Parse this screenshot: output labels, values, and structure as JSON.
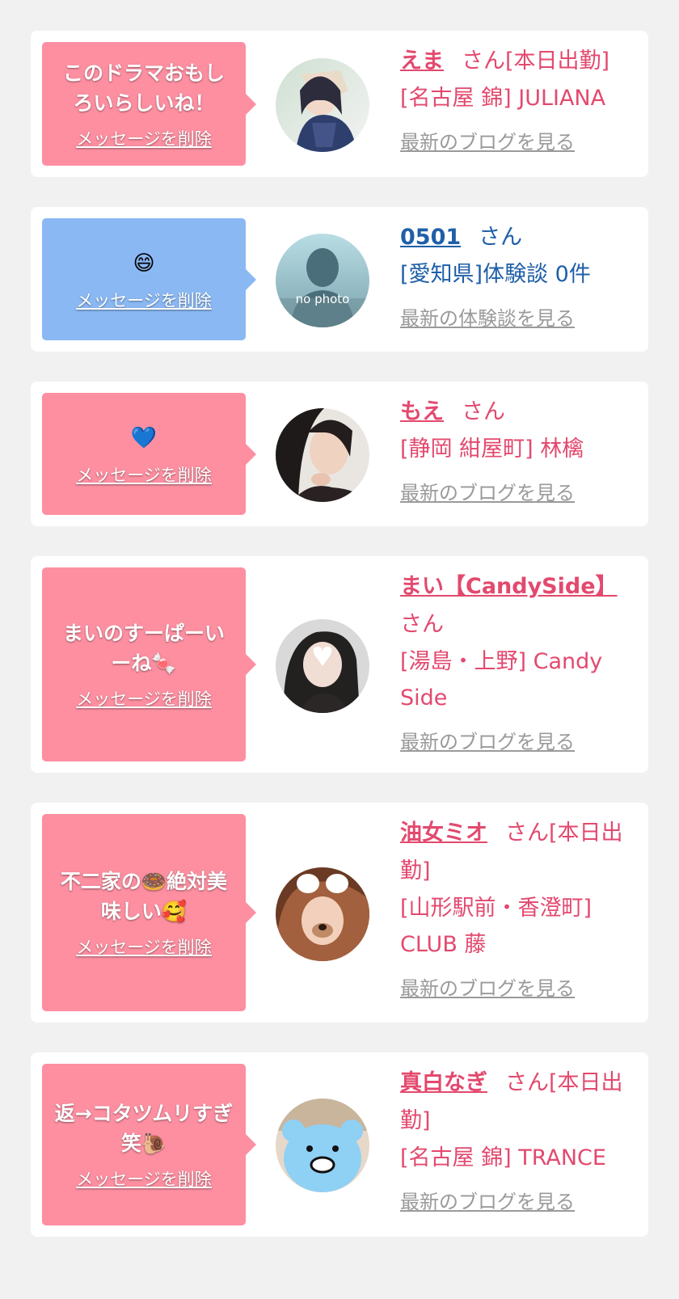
{
  "colors": {
    "page_bg": "#f1f1f1",
    "card_bg": "#ffffff",
    "bubble_pink": "#fd8fa1",
    "bubble_blue": "#8ab8f3",
    "name_pink": "#e3496e",
    "name_blue": "#1f5fa8",
    "link_gray": "#9a9a9a"
  },
  "delete_label": "メッセージを削除",
  "cards": [
    {
      "message": "このドラマおもしろいらしいね！",
      "emoji": "",
      "name": "えま",
      "suffix": "さん[本日出勤]",
      "area": "[名古屋 錦] JULIANA",
      "link": "最新のブログを見る",
      "bubble_color": "pink",
      "avatar": "photo"
    },
    {
      "message": "",
      "emoji": "😄",
      "name": "0501",
      "suffix": "さん",
      "area": "[愛知県]体験談 0件",
      "link": "最新の体験談を見る",
      "bubble_color": "blue",
      "avatar": "no-photo",
      "avatar_text": "no photo"
    },
    {
      "message": "",
      "emoji": "💙",
      "name": "もえ",
      "suffix": "さん",
      "area": "[静岡 紺屋町] 林檎",
      "link": "最新のブログを見る",
      "bubble_color": "pink",
      "avatar": "photo"
    },
    {
      "message": "まいのすーぱーいーね🍬",
      "emoji": "",
      "name": "まい【CandySide】",
      "suffix": "さん",
      "area": "[湯島・上野] Candy Side",
      "link": "最新のブログを見る",
      "bubble_color": "pink",
      "avatar": "photo"
    },
    {
      "message": "不二家の🍩絶対美味しい🥰",
      "emoji": "",
      "name": "油女ミオ",
      "suffix": "さん[本日出勤]",
      "area": "[山形駅前・香澄町] CLUB 藤",
      "link": "最新のブログを見る",
      "bubble_color": "pink",
      "avatar": "photo"
    },
    {
      "message": "返→コタツムリすぎ笑🐌",
      "emoji": "",
      "name": "真白なぎ",
      "suffix": "さん[本日出勤]",
      "area": "[名古屋 錦] TRANCE",
      "link": "最新のブログを見る",
      "bubble_color": "pink",
      "avatar": "bear"
    }
  ]
}
